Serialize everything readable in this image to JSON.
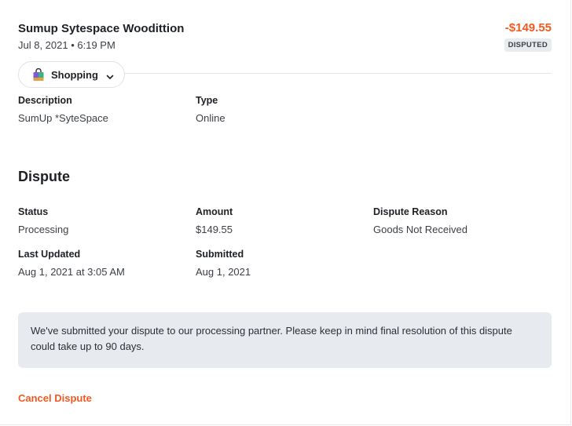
{
  "transaction": {
    "merchant": "Sumup Sytespace Woodittion",
    "datetime": "Jul 8, 2021 • 6:19 PM",
    "amount": "-$149.55",
    "status_badge": "DISPUTED",
    "category": {
      "label": "Shopping",
      "icon": "shopping-bag-icon"
    },
    "details": [
      {
        "label": "Description",
        "value": "SumUp *SyteSpace"
      },
      {
        "label": "Type",
        "value": "Online"
      }
    ]
  },
  "dispute": {
    "title": "Dispute",
    "fields": [
      {
        "label": "Status",
        "value": "Processing"
      },
      {
        "label": "Amount",
        "value": "$149.55"
      },
      {
        "label": "Dispute Reason",
        "value": "Goods Not Received"
      },
      {
        "label": "Last Updated",
        "value": "Aug 1, 2021 at 3:05 AM"
      },
      {
        "label": "Submitted",
        "value": "Aug 1, 2021"
      }
    ],
    "notice": "We've submitted your dispute to our processing partner. Please keep in mind final resolution of this dispute could take up to 90 days.",
    "cancel_label": "Cancel Dispute"
  },
  "colors": {
    "accent": "#f05a22",
    "badge_bg": "#e9ecef",
    "notice_bg": "#e7eaee"
  }
}
